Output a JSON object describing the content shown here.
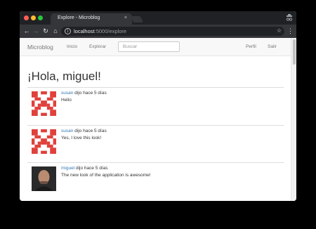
{
  "browser": {
    "tab_title": "Explore - Microblog",
    "tab_close": "×",
    "url_host": "localhost",
    "url_path": ":5000/explore",
    "info_glyph": "i"
  },
  "navbar": {
    "brand": "Microblog",
    "links": [
      "Inicio",
      "Explorar"
    ],
    "right_links": [
      "Perfil",
      "Salir"
    ],
    "search_placeholder": "Buscar"
  },
  "page": {
    "greeting": "¡Hola, miguel!"
  },
  "posts": [
    {
      "user": "susan",
      "meta": " dijo hace 5 días",
      "body": "Hello"
    },
    {
      "user": "susan",
      "meta": " dijo hace 5 días",
      "body": "Yes, I love this look!"
    },
    {
      "user": "miguel",
      "meta": " dijo hace 5 días",
      "body": "The new look of the application is awesome!"
    }
  ],
  "colors": {
    "link": "#337ab7",
    "identicon": "#e0413c"
  },
  "icons": {
    "back": "←",
    "forward": "→",
    "reload": "↻",
    "home": "⌂",
    "star": "☆",
    "menu": "⋮"
  }
}
